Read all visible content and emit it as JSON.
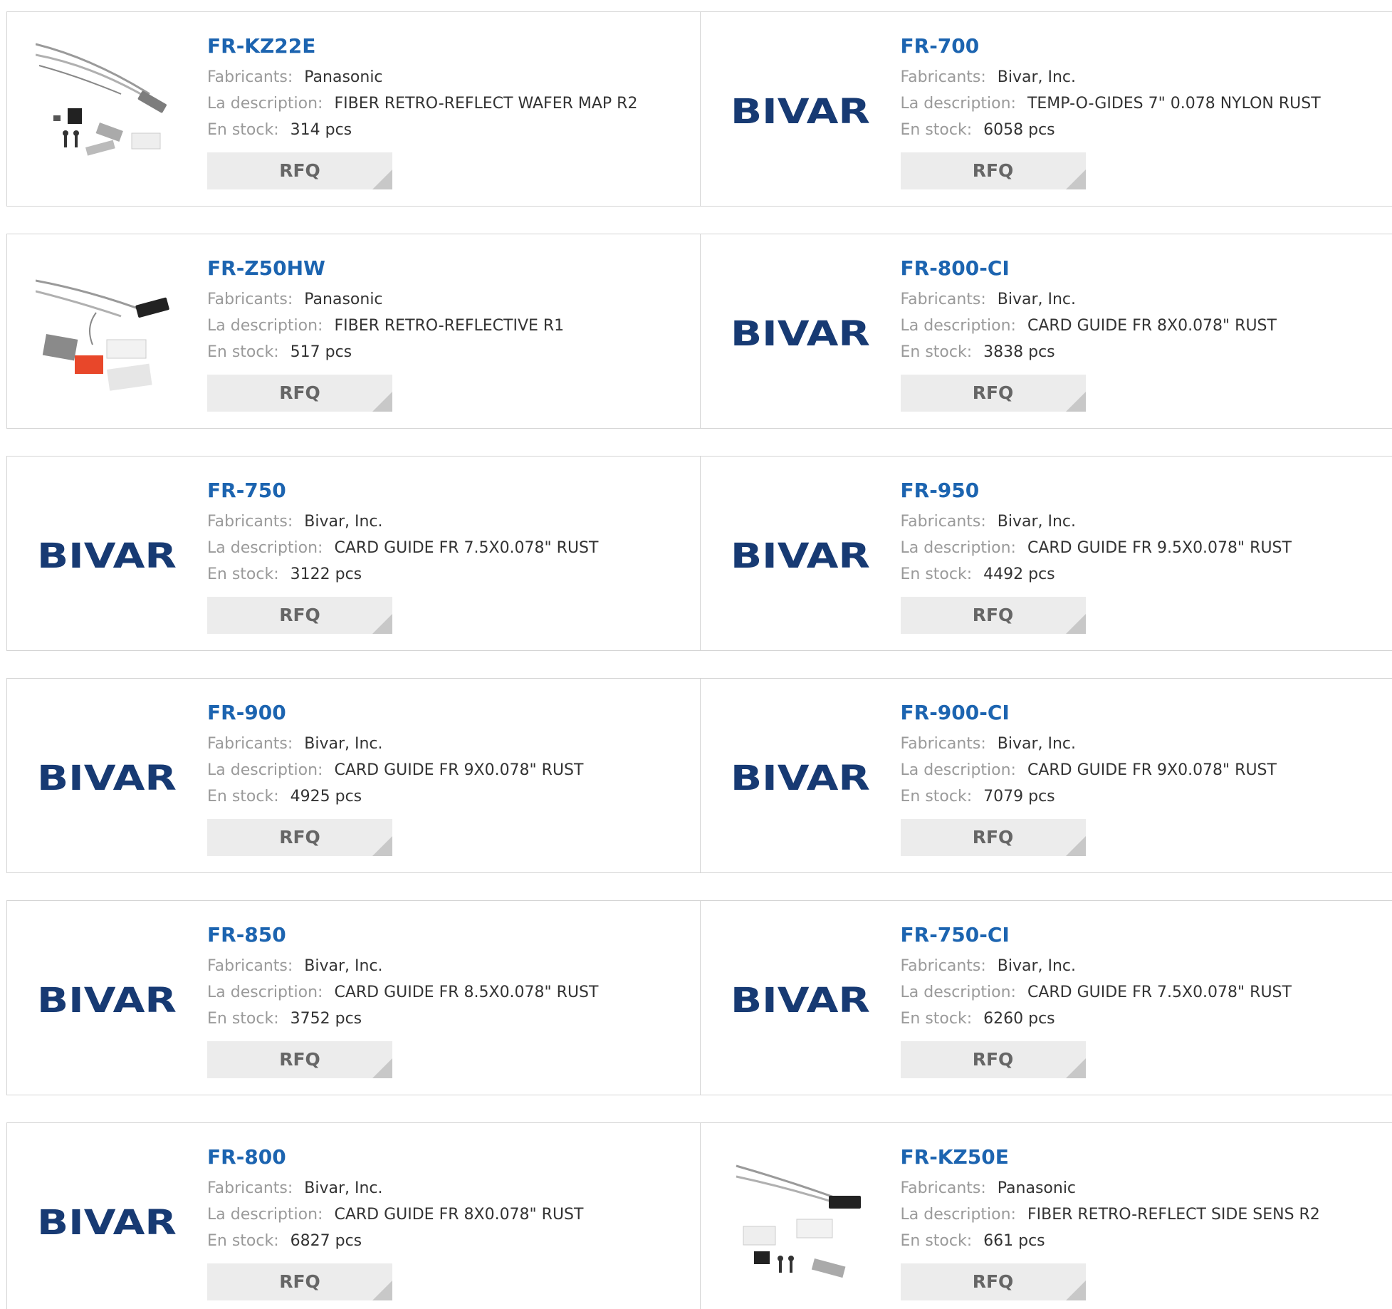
{
  "labels": {
    "manufacturer": "Fabricants:",
    "description": "La description:",
    "stock": "En stock:",
    "rfq": "RFQ"
  },
  "colors": {
    "part_link": "#1c64b0",
    "label": "#9a9a9a",
    "value": "#333333",
    "rfq_bg": "#ececec",
    "border": "#d4d4d4",
    "bivar_logo": "#173a73"
  },
  "products": [
    {
      "part": "FR-KZ22E",
      "manufacturer": "Panasonic",
      "description": "FIBER RETRO-REFLECT WAFER MAP R2",
      "stock": "314 pcs",
      "image": "fiber-kit-photo"
    },
    {
      "part": "FR-700",
      "manufacturer": "Bivar, Inc.",
      "description": "TEMP-O-GIDES 7\" 0.078 NYLON RUST",
      "stock": "6058 pcs",
      "image": "bivar-logo",
      "logo_text": "BIVAR"
    },
    {
      "part": "FR-Z50HW",
      "manufacturer": "Panasonic",
      "description": "FIBER RETRO-REFLECTIVE R1",
      "stock": "517 pcs",
      "image": "fiber-kit-photo-red"
    },
    {
      "part": "FR-800-CI",
      "manufacturer": "Bivar, Inc.",
      "description": "CARD GUIDE FR 8X0.078\" RUST",
      "stock": "3838 pcs",
      "image": "bivar-logo",
      "logo_text": "BIVAR"
    },
    {
      "part": "FR-750",
      "manufacturer": "Bivar, Inc.",
      "description": "CARD GUIDE FR 7.5X0.078\" RUST",
      "stock": "3122 pcs",
      "image": "bivar-logo",
      "logo_text": "BIVAR"
    },
    {
      "part": "FR-950",
      "manufacturer": "Bivar, Inc.",
      "description": "CARD GUIDE FR 9.5X0.078\" RUST",
      "stock": "4492 pcs",
      "image": "bivar-logo",
      "logo_text": "BIVAR"
    },
    {
      "part": "FR-900",
      "manufacturer": "Bivar, Inc.",
      "description": "CARD GUIDE FR 9X0.078\" RUST",
      "stock": "4925 pcs",
      "image": "bivar-logo",
      "logo_text": "BIVAR"
    },
    {
      "part": "FR-900-CI",
      "manufacturer": "Bivar, Inc.",
      "description": "CARD GUIDE FR 9X0.078\" RUST",
      "stock": "7079 pcs",
      "image": "bivar-logo",
      "logo_text": "BIVAR"
    },
    {
      "part": "FR-850",
      "manufacturer": "Bivar, Inc.",
      "description": "CARD GUIDE FR 8.5X0.078\" RUST",
      "stock": "3752 pcs",
      "image": "bivar-logo",
      "logo_text": "BIVAR"
    },
    {
      "part": "FR-750-CI",
      "manufacturer": "Bivar, Inc.",
      "description": "CARD GUIDE FR 7.5X0.078\" RUST",
      "stock": "6260 pcs",
      "image": "bivar-logo",
      "logo_text": "BIVAR"
    },
    {
      "part": "FR-800",
      "manufacturer": "Bivar, Inc.",
      "description": "CARD GUIDE FR 8X0.078\" RUST",
      "stock": "6827 pcs",
      "image": "bivar-logo",
      "logo_text": "BIVAR"
    },
    {
      "part": "FR-KZ50E",
      "manufacturer": "Panasonic",
      "description": "FIBER RETRO-REFLECT SIDE SENS R2",
      "stock": "661 pcs",
      "image": "fiber-kit-photo-2"
    }
  ]
}
